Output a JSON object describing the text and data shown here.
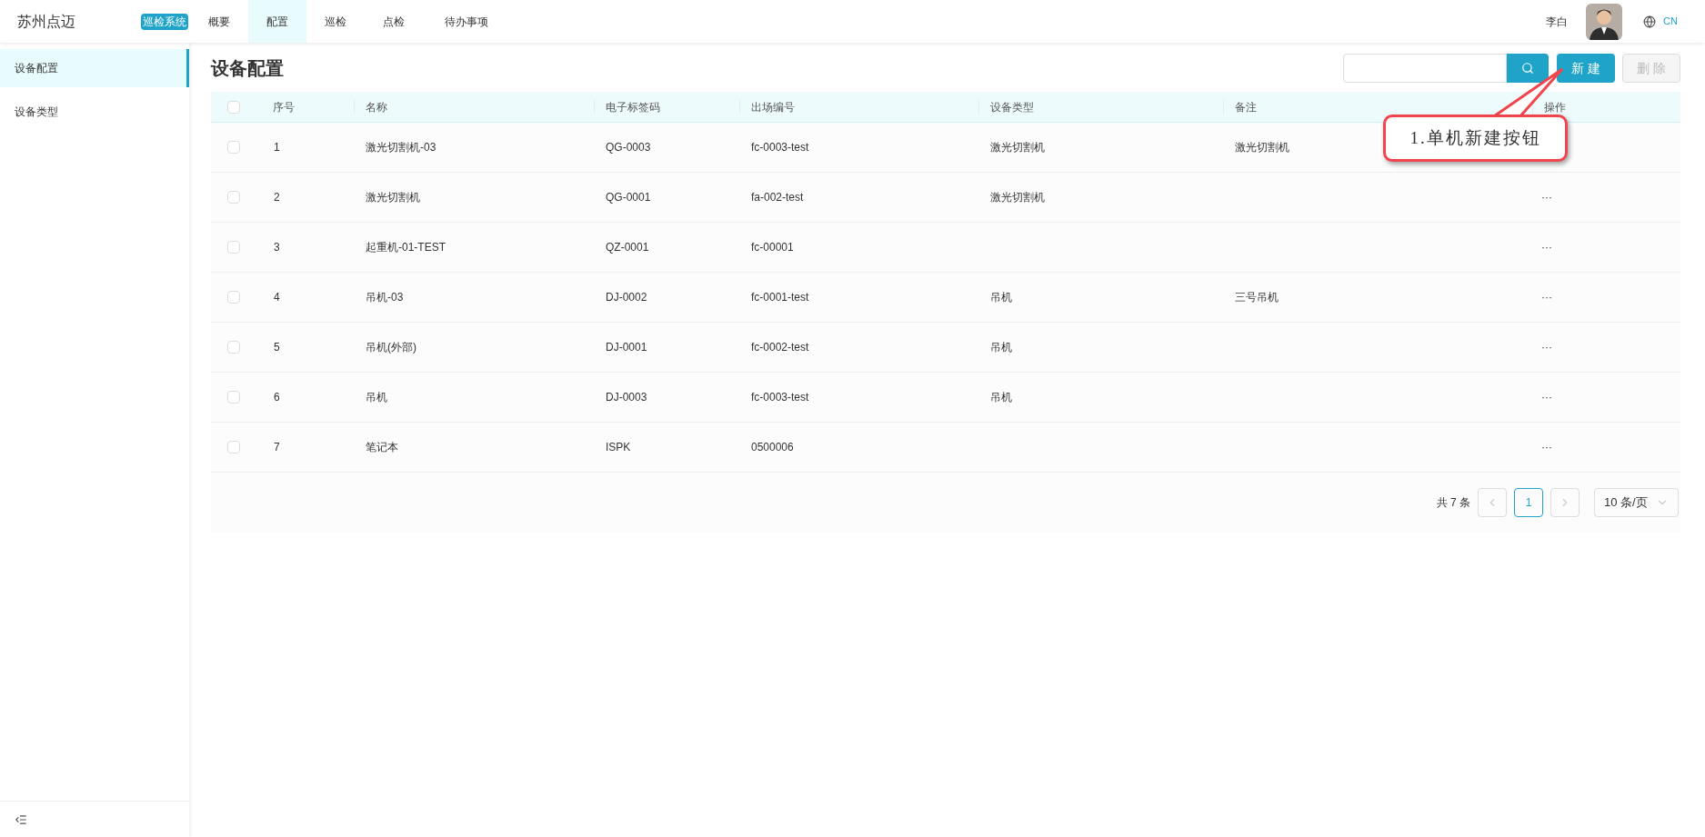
{
  "brand": "苏州点迈",
  "system_badge": "巡检系统",
  "nav": [
    {
      "label": "概要",
      "selected": false
    },
    {
      "label": "配置",
      "selected": true
    },
    {
      "label": "巡检",
      "selected": false
    },
    {
      "label": "点检",
      "selected": false
    },
    {
      "label": "待办事项",
      "selected": false
    }
  ],
  "user": {
    "name": "李白",
    "language": "CN",
    "language_selected": true
  },
  "sidebar": {
    "items": [
      {
        "label": "设备配置",
        "selected": true
      },
      {
        "label": "设备类型",
        "selected": false
      }
    ]
  },
  "page_title": "设备配置",
  "toolbar": {
    "new_button": "新 建",
    "delete_button": {
      "label": "删 除",
      "disabled": true
    }
  },
  "table": {
    "all_checked": false,
    "columns": [
      "序号",
      "名称",
      "电子标签码",
      "出场编号",
      "设备类型",
      "备注",
      "操作"
    ],
    "rows": [
      {
        "checked": false,
        "cells": [
          "1",
          "激光切割机-03",
          "QG-0003",
          "fc-0003-test",
          "激光切割机",
          "激光切割机"
        ]
      },
      {
        "checked": false,
        "cells": [
          "2",
          "激光切割机",
          "QG-0001",
          "fa-002-test",
          "激光切割机",
          ""
        ],
        "action": "···"
      },
      {
        "checked": false,
        "cells": [
          "3",
          "起重机-01-TEST",
          "QZ-0001",
          "fc-00001",
          "",
          ""
        ],
        "action": "···"
      },
      {
        "checked": false,
        "cells": [
          "4",
          "吊机-03",
          "DJ-0002",
          "fc-0001-test",
          "吊机",
          "三号吊机"
        ],
        "action": "···"
      },
      {
        "checked": false,
        "cells": [
          "5",
          "吊机(外部)",
          "DJ-0001",
          "fc-0002-test",
          "吊机",
          ""
        ],
        "action": "···"
      },
      {
        "checked": false,
        "cells": [
          "6",
          "吊机",
          "DJ-0003",
          "fc-0003-test",
          "吊机",
          ""
        ],
        "action": "···"
      },
      {
        "checked": false,
        "cells": [
          "7",
          "笔记本",
          "ISPK",
          "0500006",
          "",
          ""
        ],
        "action": "···"
      }
    ]
  },
  "pagination": {
    "total": "共 7 条",
    "pages": [
      {
        "label": "1",
        "selected": true
      }
    ],
    "page_size": "10 条/页"
  },
  "annotation": {
    "text": "1.单机新建按钮"
  }
}
